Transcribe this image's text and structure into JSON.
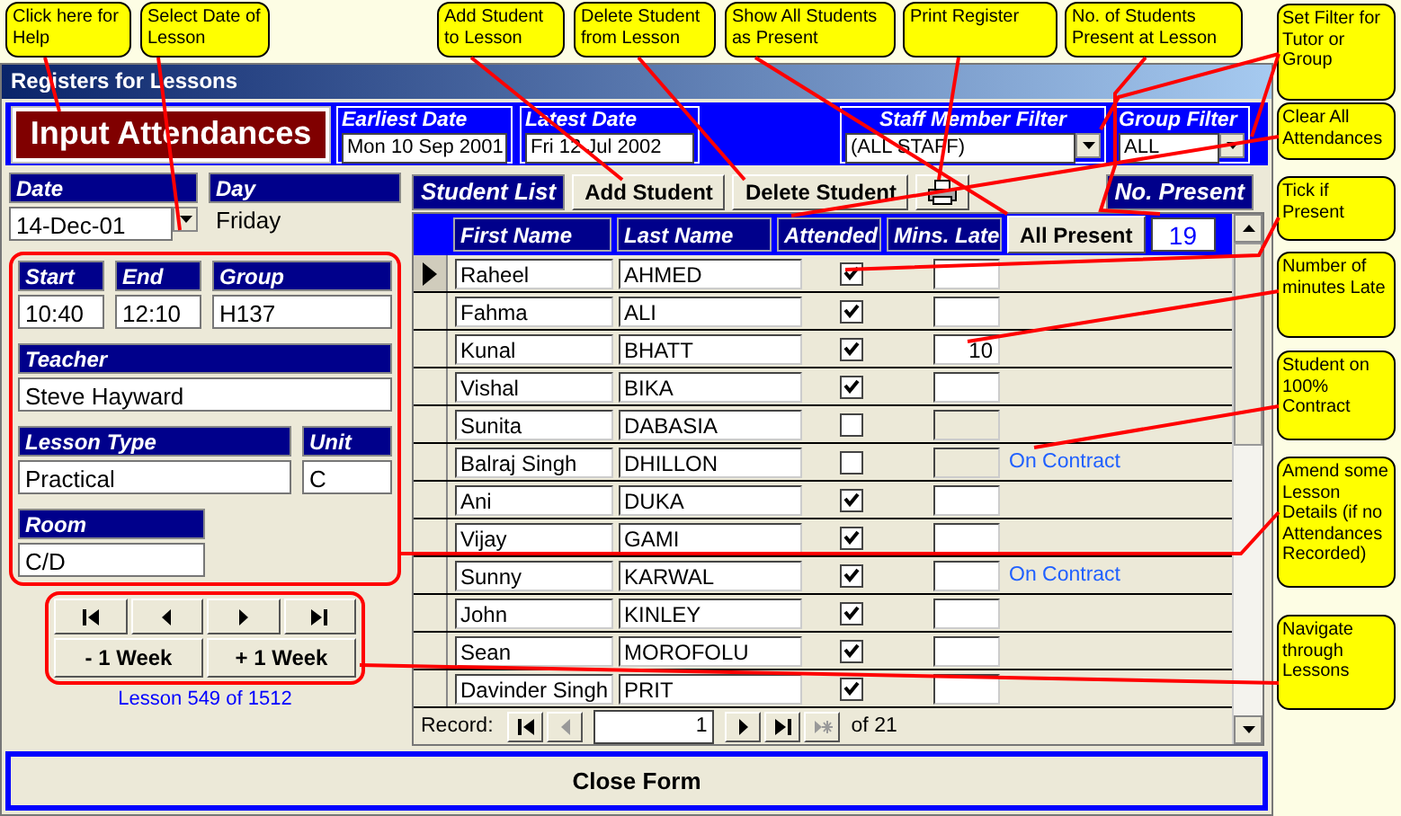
{
  "top_callouts": [
    "Click here for Help",
    "Select Date of Lesson",
    "Add Student to Lesson",
    "Delete Student from Lesson",
    "Show All Students as Present",
    "Print Register",
    "No. of Students Present at Lesson"
  ],
  "side_callouts": [
    "Set Filter for Tutor or Group",
    "Clear All Attendances",
    "Tick if Present",
    "Number of minutes Late",
    "Student on 100% Contract",
    "Amend some Lesson Details (if no Attendances Recorded)",
    "Navigate through Lessons"
  ],
  "window": {
    "title": "Registers for Lessons"
  },
  "header": {
    "main_button": "Input Attendances",
    "earliest_date": {
      "label": "Earliest Date",
      "value": "Mon 10 Sep 2001"
    },
    "latest_date": {
      "label": "Latest Date",
      "value": "Fri 12 Jul 2002"
    },
    "staff_filter": {
      "label": "Staff Member Filter",
      "value": "(ALL STAFF)"
    },
    "group_filter": {
      "label": "Group Filter",
      "value": "ALL"
    }
  },
  "lesson": {
    "date": {
      "label": "Date",
      "value": "14-Dec-01"
    },
    "day": {
      "label": "Day",
      "value": "Friday"
    },
    "start": {
      "label": "Start",
      "value": "10:40"
    },
    "end": {
      "label": "End",
      "value": "12:10"
    },
    "group": {
      "label": "Group",
      "value": "H137"
    },
    "teacher": {
      "label": "Teacher",
      "value": "Steve Hayward"
    },
    "lesson_type": {
      "label": "Lesson Type",
      "value": "Practical"
    },
    "unit": {
      "label": "Unit",
      "value": "C"
    },
    "room": {
      "label": "Room",
      "value": "C/D"
    }
  },
  "navigation": {
    "minus_week": "- 1 Week",
    "plus_week": "+ 1 Week",
    "position": "Lesson 549 of 1512"
  },
  "student_list": {
    "title": "Student List",
    "add_button": "Add Student",
    "delete_button": "Delete Student",
    "present_label": "No. Present",
    "all_present_button": "All Present",
    "present_count": "19",
    "columns": [
      "First Name",
      "Last Name",
      "Attended",
      "Mins. Late"
    ],
    "rows": [
      {
        "first": "Raheel",
        "last": "AHMED",
        "attended": true,
        "mins_late": "",
        "contract": "",
        "selected": true
      },
      {
        "first": "Fahma",
        "last": "ALI",
        "attended": true,
        "mins_late": "",
        "contract": "",
        "selected": false
      },
      {
        "first": "Kunal",
        "last": "BHATT",
        "attended": true,
        "mins_late": "10",
        "contract": "",
        "selected": false
      },
      {
        "first": "Vishal",
        "last": "BIKA",
        "attended": true,
        "mins_late": "",
        "contract": "",
        "selected": false
      },
      {
        "first": "Sunita",
        "last": "DABASIA",
        "attended": false,
        "mins_late": "",
        "contract": "",
        "selected": false
      },
      {
        "first": "Balraj Singh",
        "last": "DHILLON",
        "attended": false,
        "mins_late": "",
        "contract": "On Contract",
        "selected": false
      },
      {
        "first": "Ani",
        "last": "DUKA",
        "attended": true,
        "mins_late": "",
        "contract": "",
        "selected": false
      },
      {
        "first": "Vijay",
        "last": "GAMI",
        "attended": true,
        "mins_late": "",
        "contract": "",
        "selected": false
      },
      {
        "first": "Sunny",
        "last": "KARWAL",
        "attended": true,
        "mins_late": "",
        "contract": "On Contract",
        "selected": false
      },
      {
        "first": "John",
        "last": "KINLEY",
        "attended": true,
        "mins_late": "",
        "contract": "",
        "selected": false
      },
      {
        "first": "Sean",
        "last": "MOROFOLU",
        "attended": true,
        "mins_late": "",
        "contract": "",
        "selected": false
      },
      {
        "first": "Davinder Singh",
        "last": "PRIT",
        "attended": true,
        "mins_late": "",
        "contract": "",
        "selected": false
      }
    ],
    "record_bar": {
      "label": "Record:",
      "current": "1",
      "total": "of 21"
    }
  },
  "close_button": "Close Form"
}
